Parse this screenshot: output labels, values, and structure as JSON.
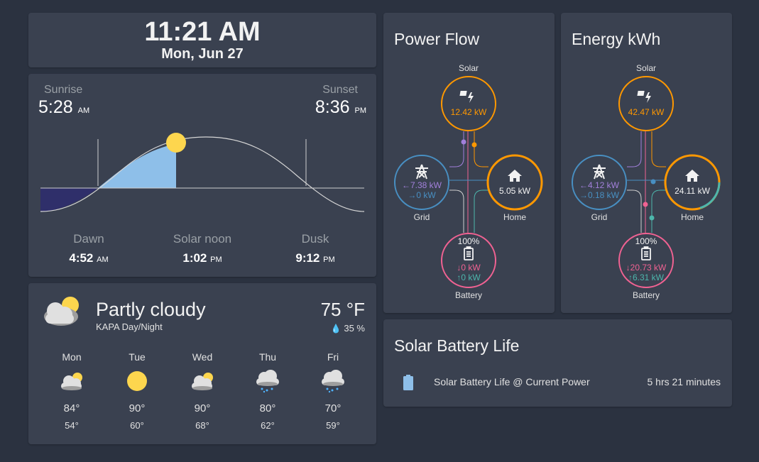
{
  "clock": {
    "time": "11:21 AM",
    "date": "Mon, Jun 27"
  },
  "sun": {
    "sunrise_label": "Sunrise",
    "sunrise_time": "5:28",
    "sunrise_ampm": "AM",
    "sunset_label": "Sunset",
    "sunset_time": "8:36",
    "sunset_ampm": "PM",
    "dawn_label": "Dawn",
    "dawn_time": "4:52",
    "dawn_ampm": "AM",
    "noon_label": "Solar noon",
    "noon_time": "1:02",
    "noon_ampm": "PM",
    "dusk_label": "Dusk",
    "dusk_time": "9:12",
    "dusk_ampm": "PM"
  },
  "weather": {
    "condition": "Partly cloudy",
    "station": "KAPA Day/Night",
    "temperature": "75 °F",
    "humidity": "35 %",
    "forecast": [
      {
        "day": "Mon",
        "icon": "partly-cloudy-icon",
        "high": "84°",
        "low": "54°"
      },
      {
        "day": "Tue",
        "icon": "sunny-icon",
        "high": "90°",
        "low": "60°"
      },
      {
        "day": "Wed",
        "icon": "partly-cloudy-icon",
        "high": "90°",
        "low": "68°"
      },
      {
        "day": "Thu",
        "icon": "rainy-icon",
        "high": "80°",
        "low": "62°"
      },
      {
        "day": "Fri",
        "icon": "rainy-icon",
        "high": "70°",
        "low": "59°"
      }
    ]
  },
  "power_flow": {
    "title": "Power Flow",
    "solar_label": "Solar",
    "solar_value": "12.42 kW",
    "grid_label": "Grid",
    "grid_in": "7.38 kW",
    "grid_out": "0 kW",
    "home_label": "Home",
    "home_value": "5.05 kW",
    "battery_label": "Battery",
    "battery_pct": "100%",
    "battery_in": "0 kW",
    "battery_out": "0 kW"
  },
  "energy": {
    "title": "Energy kWh",
    "solar_label": "Solar",
    "solar_value": "42.47 kW",
    "grid_label": "Grid",
    "grid_in": "4.12 kW",
    "grid_out": "0.18 kW",
    "home_label": "Home",
    "home_value": "24.11 kW",
    "battery_label": "Battery",
    "battery_pct": "100%",
    "battery_in": "20.73 kW",
    "battery_out": "6.31 kW"
  },
  "battery_life": {
    "title": "Solar Battery Life",
    "entity_name": "Solar Battery Life @ Current Power",
    "entity_value": "5 hrs 21 minutes",
    "icon": "battery-icon"
  },
  "colors": {
    "solar": "#ff9800",
    "grid": "#488fc2",
    "grid_in": "#a280db",
    "home": "#ff9800",
    "battery": "#f06292",
    "battery_out": "#4db6ac"
  }
}
